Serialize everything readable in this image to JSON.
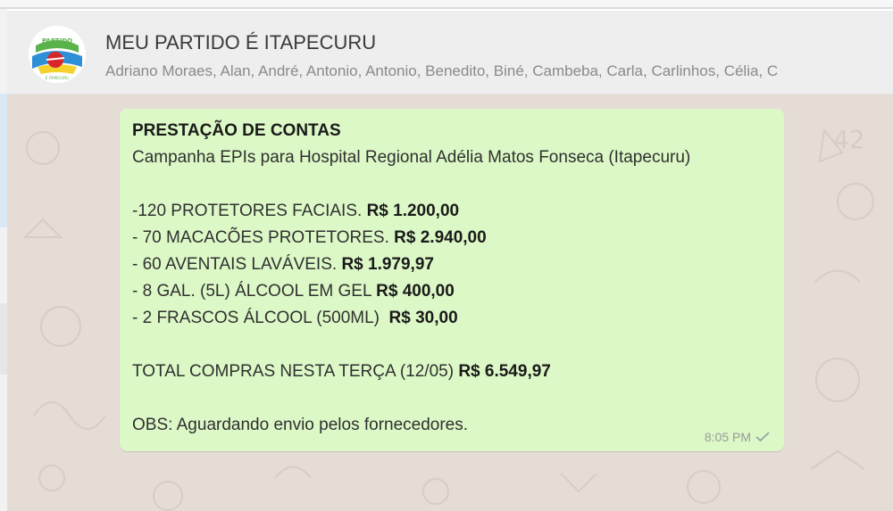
{
  "header": {
    "title": "MEU PARTIDO É ITAPECURU",
    "members": "Adriano Moraes, Alan, André, Antonio, Antonio, Benedito, Biné, Cambeba, Carla, Carlinhos, Célia, C",
    "avatar_text": "PARTIDO",
    "avatar_subtext": "É ITAPECURU"
  },
  "message": {
    "title": "PRESTAÇÃO DE CONTAS",
    "subtitle": "Campanha EPIs para Hospital Regional Adélia Matos Fonseca (Itapecuru)",
    "items": [
      {
        "desc": "-120 PROTETORES FACIAIS. ",
        "value": "R$ 1.200,00"
      },
      {
        "desc": "- 70 MACACÕES PROTETORES. ",
        "value": "R$ 2.940,00"
      },
      {
        "desc": "- 60 AVENTAIS LAVÁVEIS. ",
        "value": "R$ 1.979,97"
      },
      {
        "desc": "- 8 GAL. (5L) ÁLCOOL EM GEL ",
        "value": "R$ 400,00"
      },
      {
        "desc": "- 2 FRASCOS ÁLCOOL (500ML)  ",
        "value": "R$ 30,00"
      }
    ],
    "total_label": "TOTAL COMPRAS NESTA TERÇA (12/05) ",
    "total_value": "R$ 6.549,97",
    "obs": "OBS: Aguardando envio pelos fornecedores.",
    "time": "8:05 PM",
    "status_icon": "single-check-icon"
  },
  "colors": {
    "bubble": "#dcf8c6",
    "chat_background": "#e5ddd5",
    "header_background": "#eeeeee"
  }
}
